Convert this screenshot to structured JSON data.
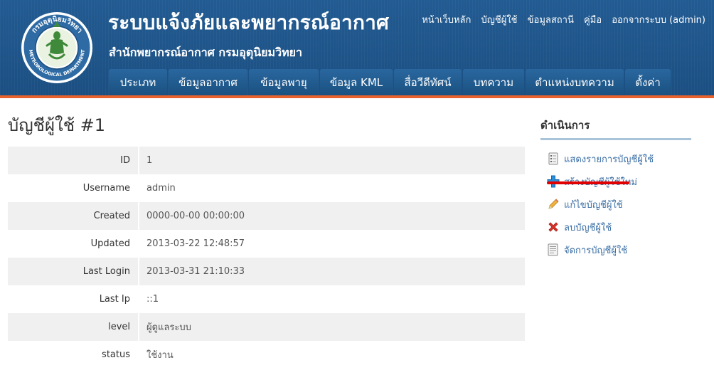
{
  "header": {
    "title": "ระบบแจ้งภัยและพยากรณ์อากาศ",
    "subtitle": "สำนักพยากรณ์อากาศ กรมอุตุนิยมวิทยา",
    "logo_text_top": "กรมอุตุนิยมวิทยา",
    "logo_text_bottom": "METEOROLOGICAL DEPARTMENT",
    "top_links": [
      "หน้าเว็บหลัก",
      "บัญชีผู้ใช้",
      "ข้อมูลสถานี",
      "คู่มือ",
      "ออกจากระบบ (admin)"
    ],
    "nav_tabs": [
      "ประเภท",
      "ข้อมูลอากาศ",
      "ข้อมูลพายุ",
      "ข้อมูล KML",
      "สื่อวีดีทัศน์",
      "บทความ",
      "ตำแหน่งบทความ",
      "ตั้งค่า"
    ],
    "colors": {
      "header_bg": "#1e5487",
      "accent_line": "#e8622c",
      "tab_bg": "#1f5a8d"
    }
  },
  "content": {
    "page_title": "บัญชีผู้ใช้ #1",
    "rows": [
      {
        "label": "ID",
        "value": "1"
      },
      {
        "label": "Username",
        "value": "admin"
      },
      {
        "label": "Created",
        "value": "0000-00-00 00:00:00"
      },
      {
        "label": "Updated",
        "value": "2013-03-22 12:48:57"
      },
      {
        "label": "Last Login",
        "value": "2013-03-31 21:10:33"
      },
      {
        "label": "Last Ip",
        "value": "::1"
      },
      {
        "label": "level",
        "value": "ผู้ดูแลระบบ"
      },
      {
        "label": "status",
        "value": "ใช้งาน"
      }
    ]
  },
  "sidebar": {
    "title": "ดำเนินการ",
    "operations": [
      {
        "label": "แสดงรายการบัญชีผู้ใช้",
        "icon": "list-document-icon"
      },
      {
        "label": "สร้างบัญชีผู้ใช้ใหม่",
        "icon": "plus-icon"
      },
      {
        "label": "แก้ไขบัญชีผู้ใช้",
        "icon": "pencil-icon"
      },
      {
        "label": "ลบบัญชีผู้ใช้",
        "icon": "delete-x-icon"
      },
      {
        "label": "จัดการบัญชีผู้ใช้",
        "icon": "manage-document-icon"
      }
    ],
    "link_color": "#3a6ea5",
    "highlight_color": "#e10000"
  }
}
